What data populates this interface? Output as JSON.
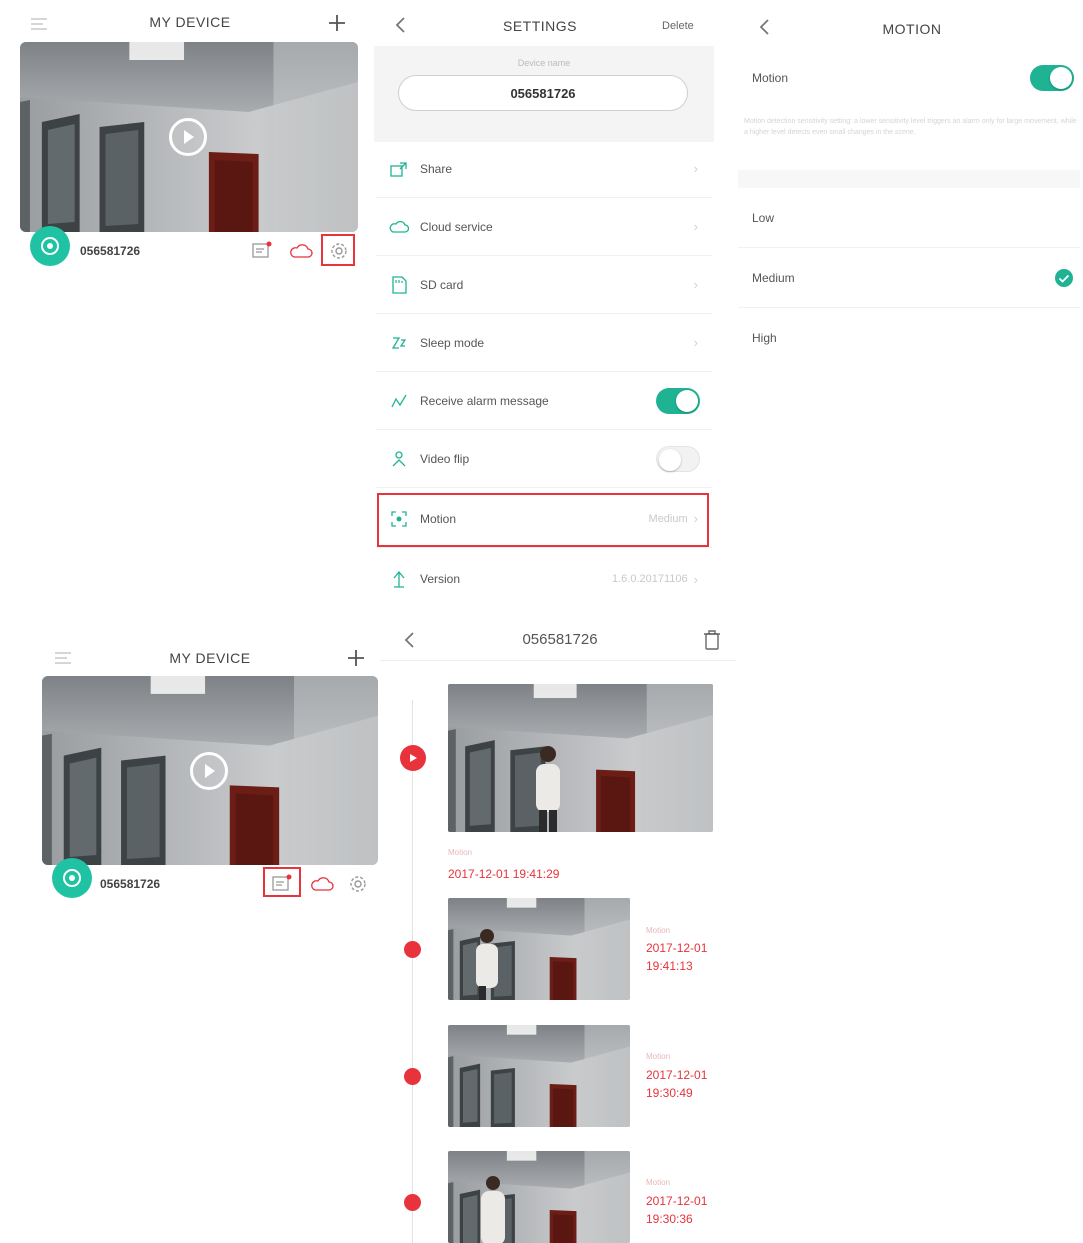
{
  "home_top": {
    "title": "MY DEVICE",
    "device_name": "056581726"
  },
  "home_bottom": {
    "title": "MY DEVICE",
    "device_name": "056581726"
  },
  "settings": {
    "title": "SETTINGS",
    "delete_label": "Delete",
    "device_name_label": "Device name",
    "device_name": "056581726",
    "rows": [
      {
        "label": "Share",
        "icon": "share-icon",
        "value": ""
      },
      {
        "label": "Cloud service",
        "icon": "cloud-icon",
        "value": ""
      },
      {
        "label": "SD card",
        "icon": "sd-card-icon",
        "value": ""
      },
      {
        "label": "Sleep mode",
        "icon": "sleep-icon",
        "value": ""
      },
      {
        "label": "Receive alarm message",
        "icon": "alarm-icon",
        "value": ""
      },
      {
        "label": "Video flip",
        "icon": "flip-icon",
        "value": ""
      },
      {
        "label": "Motion",
        "icon": "motion-icon",
        "value": "Medium"
      },
      {
        "label": "Version",
        "icon": "version-icon",
        "value": "1.6.0.20171106"
      }
    ],
    "alarm_enabled": true,
    "flip_enabled": false
  },
  "motion": {
    "title": "MOTION",
    "toggle_label": "Motion",
    "enabled": true,
    "description": "Motion detection sensitivity setting: a lower sensitivity level triggers an alarm only for large movement, while a higher level detects even small changes in the scene.",
    "options": [
      "Low",
      "Medium",
      "High"
    ],
    "selected": "Medium"
  },
  "events": {
    "title": "056581726",
    "items": [
      {
        "tag": "Motion",
        "date": "2017-12-01",
        "time": "19:41:29"
      },
      {
        "tag": "Motion",
        "date": "2017-12-01",
        "time": "19:41:13"
      },
      {
        "tag": "Motion",
        "date": "2017-12-01",
        "time": "19:30:49"
      },
      {
        "tag": "Motion",
        "date": "2017-12-01",
        "time": "19:30:36"
      }
    ]
  },
  "colors": {
    "accent": "#1fb394",
    "alert": "#e8333c",
    "highlight_box": "#e8333c"
  }
}
